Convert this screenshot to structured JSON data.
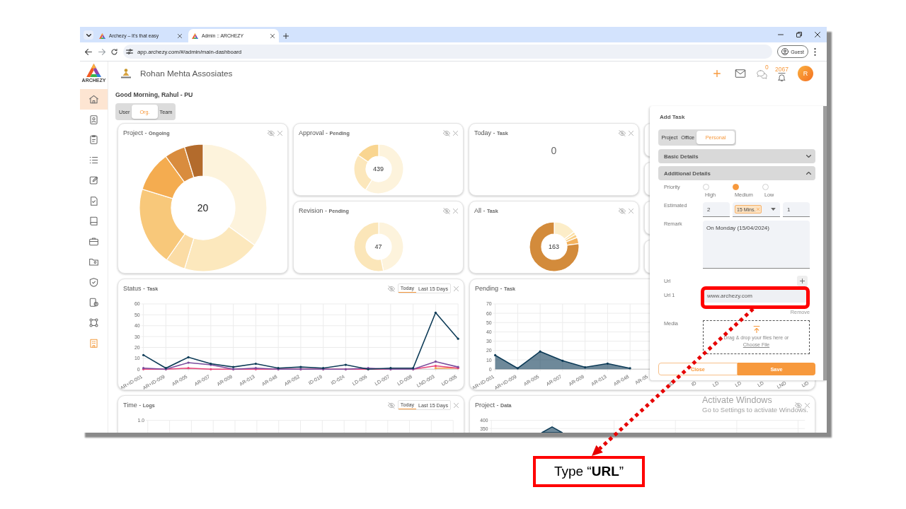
{
  "browser": {
    "tabs": [
      {
        "title": "Archezy – It's that easy",
        "selected": false
      },
      {
        "title": "Admin :: ARCHEZY",
        "selected": true
      }
    ],
    "url": "app.archezy.com/#/admin/main-dashboard",
    "profile": "Guest"
  },
  "sidebar": {
    "logo_text": "ARCHEZY",
    "items": [
      {
        "selected": true
      },
      {
        "selected": false
      },
      {
        "selected": false
      },
      {
        "selected": false
      },
      {
        "selected": false
      },
      {
        "selected": false
      },
      {
        "selected": false
      },
      {
        "selected": false
      },
      {
        "selected": false
      },
      {
        "selected": false
      },
      {
        "selected": false
      },
      {
        "selected": false
      },
      {
        "selected": false
      }
    ]
  },
  "header": {
    "company": "Rohan Mehta Assosiates",
    "chat_count": "0",
    "notification_count": "2067",
    "avatar_initial": "R"
  },
  "dashboard": {
    "greeting": "Good Morning, Rahul - PU",
    "views": [
      {
        "label": "User",
        "selected": false
      },
      {
        "label": "Org.",
        "selected": true
      },
      {
        "label": "Team",
        "selected": false
      }
    ]
  },
  "cards": [
    {
      "kind": "donut",
      "title": "Project - **Ongoing**",
      "center": "20"
    },
    {
      "kind": "donut",
      "title": "Approval - **Pending**",
      "center": "439"
    },
    {
      "kind": "donut",
      "title": "Revision - **Pending**",
      "center": "47"
    },
    {
      "kind": "count",
      "title": "Today - **Task**",
      "center": "0"
    },
    {
      "kind": "donut",
      "title": "All - **Task**",
      "center": "163"
    }
  ],
  "charts": [
    {
      "kind": "chart",
      "title": "Status - **Task**",
      "range_options": [
        {
          "label": "Today",
          "selected": true
        },
        {
          "label": "Last 15 Days",
          "selected": false
        }
      ],
      "chart_data": {
        "type": "line",
        "grid": true,
        "categories": [
          "AR+ID-001",
          "AR+ID-009",
          "AR-005",
          "AR-007",
          "AR-009",
          "AR-013",
          "AR-048",
          "AR-052",
          "ID-019",
          "ID-024",
          "LD-006",
          "LD-007",
          "LD-008",
          "LND-003",
          "UD-005"
        ],
        "ylim": [
          0,
          60
        ],
        "yticks": [
          0,
          10,
          20,
          30,
          40,
          50,
          60
        ],
        "series": [
          {
            "color": "#0d3b57",
            "marker": true,
            "values": [
              13,
              1,
              11,
              5,
              2,
              5,
              1,
              2,
              1,
              4,
              0,
              1,
              1,
              52,
              28
            ]
          },
          {
            "color": "#7a4c9c",
            "marker": true,
            "values": [
              1,
              0,
              6,
              4,
              0,
              1,
              0,
              0,
              0,
              0,
              1,
              0,
              0,
              7,
              2
            ]
          },
          {
            "color": "#e8417a",
            "marker": true,
            "values": [
              0,
              0,
              1,
              0,
              0,
              0,
              0,
              0,
              0,
              0,
              0,
              0,
              0,
              3,
              1
            ]
          },
          {
            "color": "#f5a04a",
            "marker": true,
            "values": [
              null,
              null,
              null,
              null,
              null,
              null,
              null,
              null,
              null,
              null,
              null,
              null,
              null,
              1,
              1
            ]
          }
        ]
      }
    },
    {
      "kind": "chart",
      "title": "Pending - **Task**",
      "chart_data": {
        "type": "area",
        "grid": true,
        "categories": [
          "AR+ID-001",
          "AR+ID-009",
          "AR-005",
          "AR-007",
          "AR-009",
          "AR-013",
          "AR-048",
          "AR-05",
          "ID",
          "ID",
          "LD",
          "LD",
          "LD",
          "LND",
          "UD"
        ],
        "ylim": [
          0,
          70
        ],
        "yticks": [
          0,
          10,
          20,
          30,
          40,
          50,
          60,
          70
        ],
        "series": [
          {
            "color": "#0d3b57",
            "marker": true,
            "values": [
              15,
              1,
              19,
              9,
              2,
              6,
              1,
              null,
              null,
              null,
              null,
              null,
              null,
              null,
              null
            ]
          }
        ]
      }
    },
    {
      "kind": "frame",
      "title": "Time - **Logs**",
      "range_options": [
        {
          "label": "Today",
          "selected": true
        },
        {
          "label": "Last 15 Days",
          "selected": false
        }
      ],
      "y_ticks": [
        "1.0"
      ]
    },
    {
      "kind": "trend",
      "title": "Project - **Data**",
      "y_ticks": [
        "400",
        "350"
      ]
    }
  ],
  "add_task": {
    "title": "Add Task",
    "types": [
      {
        "label": "Project",
        "selected": false
      },
      {
        "label": "Office",
        "selected": false
      },
      {
        "label": "Personal",
        "selected": true
      }
    ],
    "sections": [
      {
        "label": "Basic Details",
        "expanded": false
      },
      {
        "label": "Additional Details",
        "expanded": true,
        "fields": {
          "priority": {
            "label": "Priority",
            "options": [
              {
                "label": "High",
                "selected": false
              },
              {
                "label": "Medium",
                "selected": true
              },
              {
                "label": "Low",
                "selected": false
              }
            ]
          },
          "estimated": {
            "label": "Estimated",
            "hours": "2",
            "unit": "15 Mins.",
            "count": "1"
          },
          "remark": {
            "label": "Remark",
            "value": "On Monday (15/04/2024)"
          },
          "url": {
            "label": "Url",
            "entries": [
              {
                "label": "Url 1",
                "value": "www.archezy.com",
                "remove": "Remove"
              }
            ]
          },
          "media": {
            "label": "Media",
            "hint": "Drag & drop your files here or",
            "link": "Choose File"
          }
        }
      }
    ],
    "buttons": [
      {
        "label": "Close",
        "kind": "outline"
      },
      {
        "label": "Save",
        "kind": "primary"
      }
    ]
  },
  "os_notice": {
    "title": "Activate Windows",
    "message": "Go to Settings to activate Windows."
  },
  "callout": {
    "text": "Type “**URL**”"
  }
}
